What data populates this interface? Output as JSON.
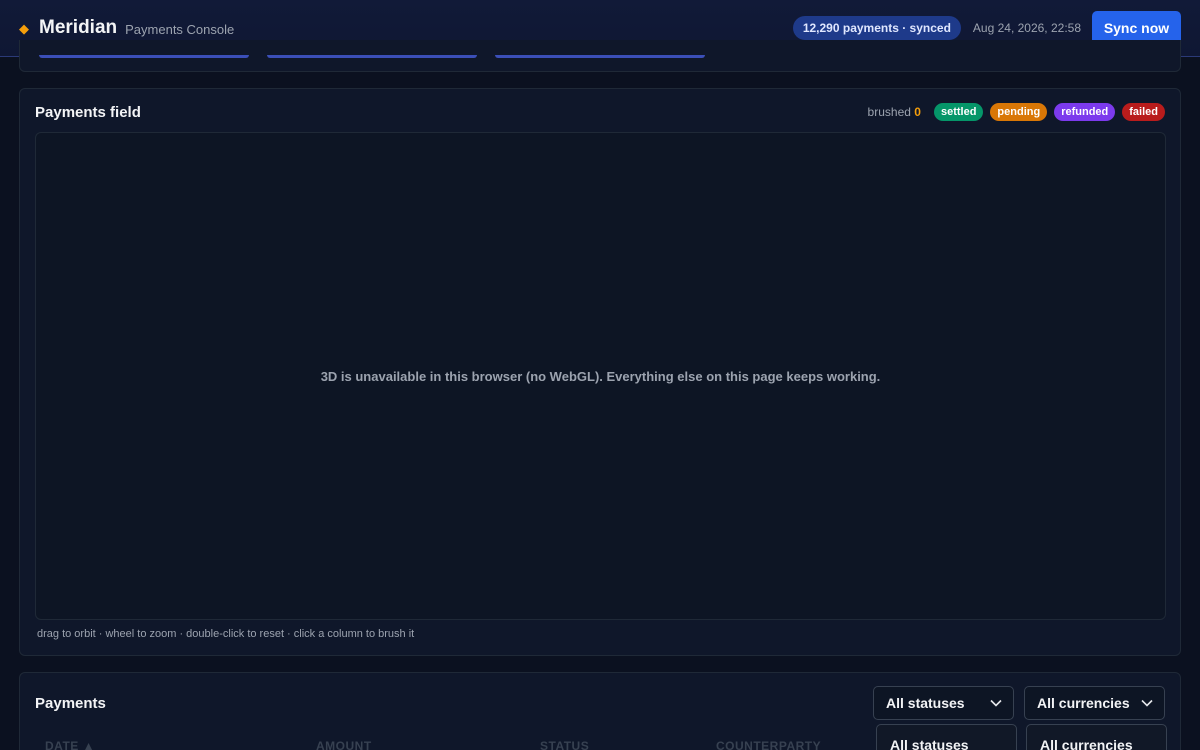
{
  "header": {
    "brand_name": "Meridian",
    "brand_sub": "Payments Console",
    "sync_status": "12,290 payments · synced",
    "sync_time": "Aug 24, 2026, 22:58",
    "sync_button": "Sync now"
  },
  "field_panel": {
    "title": "Payments field",
    "brushed_label": "brushed",
    "brushed_count": "0",
    "legend": [
      {
        "label": "settled",
        "color": "#059669"
      },
      {
        "label": "pending",
        "color": "#d97706"
      },
      {
        "label": "refunded",
        "color": "#7c3aed"
      },
      {
        "label": "failed",
        "color": "#b91c1c"
      }
    ],
    "fallback_message": "3D is unavailable in this browser (no WebGL). Everything else on this page keeps working.",
    "hint": "drag to orbit · wheel to zoom · double-click to reset · click a column to brush it"
  },
  "payments_panel": {
    "title": "Payments",
    "status_filter": "All statuses",
    "currency_filter": "All currencies",
    "columns": [
      "DATE ▲",
      "AMOUNT",
      "STATUS",
      "COUNTERPARTY"
    ],
    "status_options": [
      "All statuses"
    ],
    "currency_options": [
      "All currencies"
    ]
  },
  "colors": {
    "accent": "#2563eb",
    "brand_diamond": "#f59e0b",
    "background": "#0b1120"
  }
}
